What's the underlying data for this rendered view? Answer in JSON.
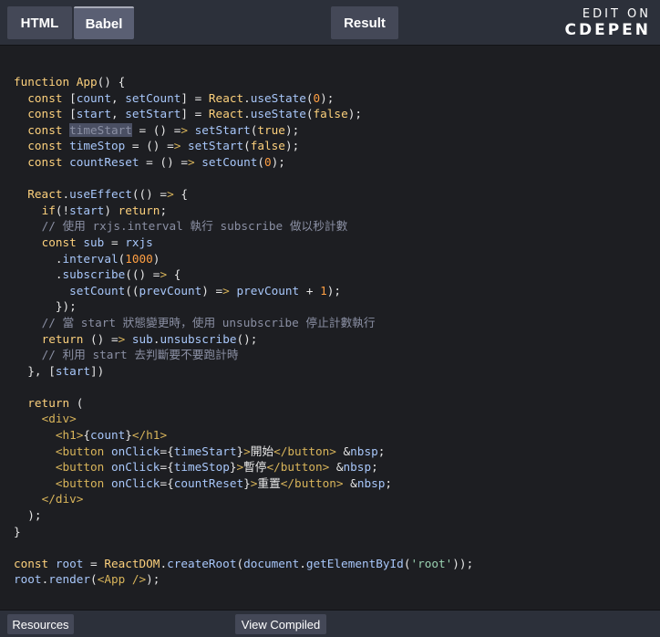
{
  "tabs": {
    "html": "HTML",
    "babel": "Babel",
    "result": "Result"
  },
  "brand": {
    "edit_on": "EDIT ON",
    "codepen_rest": "DEPEN",
    "codepen_first": "C"
  },
  "code_lines": [
    "function App() {",
    "  const [count, setCount] = React.useState(0);",
    "  const [start, setStart] = React.useState(false);",
    "  const timeStart = () => setStart(true);",
    "  const timeStop = () => setStart(false);",
    "  const countReset = () => setCount(0);",
    "",
    "  React.useEffect(() => {",
    "    if(!start) return;",
    "    // 使用 rxjs.interval 執行 subscribe 做以秒計數",
    "    const sub = rxjs",
    "      .interval(1000)",
    "      .subscribe(() => {",
    "        setCount((prevCount) => prevCount + 1);",
    "      });",
    "    // 當 start 狀態變更時，使用 unsubscribe 停止計數執行",
    "    return () => sub.unsubscribe();",
    "    // 利用 start 去判斷要不要跑計時",
    "  }, [start])",
    "",
    "  return (",
    "    <div>",
    "      <h1>{count}</h1>",
    "      <button onClick={timeStart}>開始</button> &nbsp;",
    "      <button onClick={timeStop}>暫停</button> &nbsp;",
    "      <button onClick={countReset}>重置</button> &nbsp;",
    "    </div>",
    "  );",
    "}",
    "",
    "const root = ReactDOM.createRoot(document.getElementById('root'));",
    "root.render(<App />);"
  ],
  "bottom": {
    "resources": "Resources",
    "view_compiled": "View Compiled"
  }
}
